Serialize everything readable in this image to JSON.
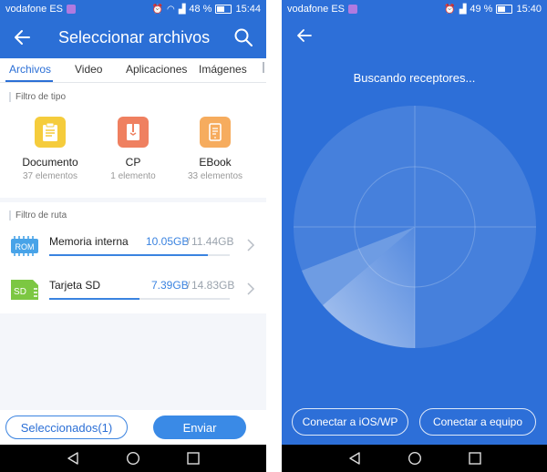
{
  "left": {
    "status": {
      "carrier": "vodafone ES",
      "battery": "48 %",
      "time": "15:44"
    },
    "header": {
      "title": "Seleccionar archivos"
    },
    "tabs": [
      {
        "label": "Archivos",
        "active": true
      },
      {
        "label": "Video"
      },
      {
        "label": "Aplicaciones"
      },
      {
        "label": "Imágenes"
      }
    ],
    "type_filter": {
      "label": "Filtro de tipo",
      "items": [
        {
          "name": "Documento",
          "count": "37 elementos",
          "icon": "clipboard-icon",
          "color": "#f5cc3c"
        },
        {
          "name": "CP",
          "count": "1 elemento",
          "icon": "archive-icon",
          "color": "#ef8060"
        },
        {
          "name": "EBook",
          "count": "33 elementos",
          "icon": "ebook-icon",
          "color": "#f6ac5e"
        }
      ]
    },
    "path_filter": {
      "label": "Filtro de ruta",
      "items": [
        {
          "name": "Memoria interna",
          "icon_text": "ROM",
          "used": "10.05GB",
          "total": "11.44GB",
          "fraction": 0.878,
          "icon": "rom-chip-icon",
          "color": "#48a3e8"
        },
        {
          "name": "Tarjeta SD",
          "icon_text": "SD",
          "used": "7.39GB",
          "total": "14.83GB",
          "fraction": 0.498,
          "icon": "sd-card-icon",
          "color": "#7cc742"
        }
      ]
    },
    "buttons": {
      "selected": "Seleccionados(1)",
      "send": "Enviar"
    }
  },
  "right": {
    "status": {
      "carrier": "vodafone ES",
      "battery": "49 %",
      "time": "15:40"
    },
    "title": "Buscando receptores...",
    "buttons": {
      "ios": "Conectar a iOS/WP",
      "pc": "Conectar a equipo"
    }
  },
  "colors": {
    "primary": "#2b6fd6",
    "radar_bg": "#2d6fd8",
    "accent": "#3a83e0"
  }
}
